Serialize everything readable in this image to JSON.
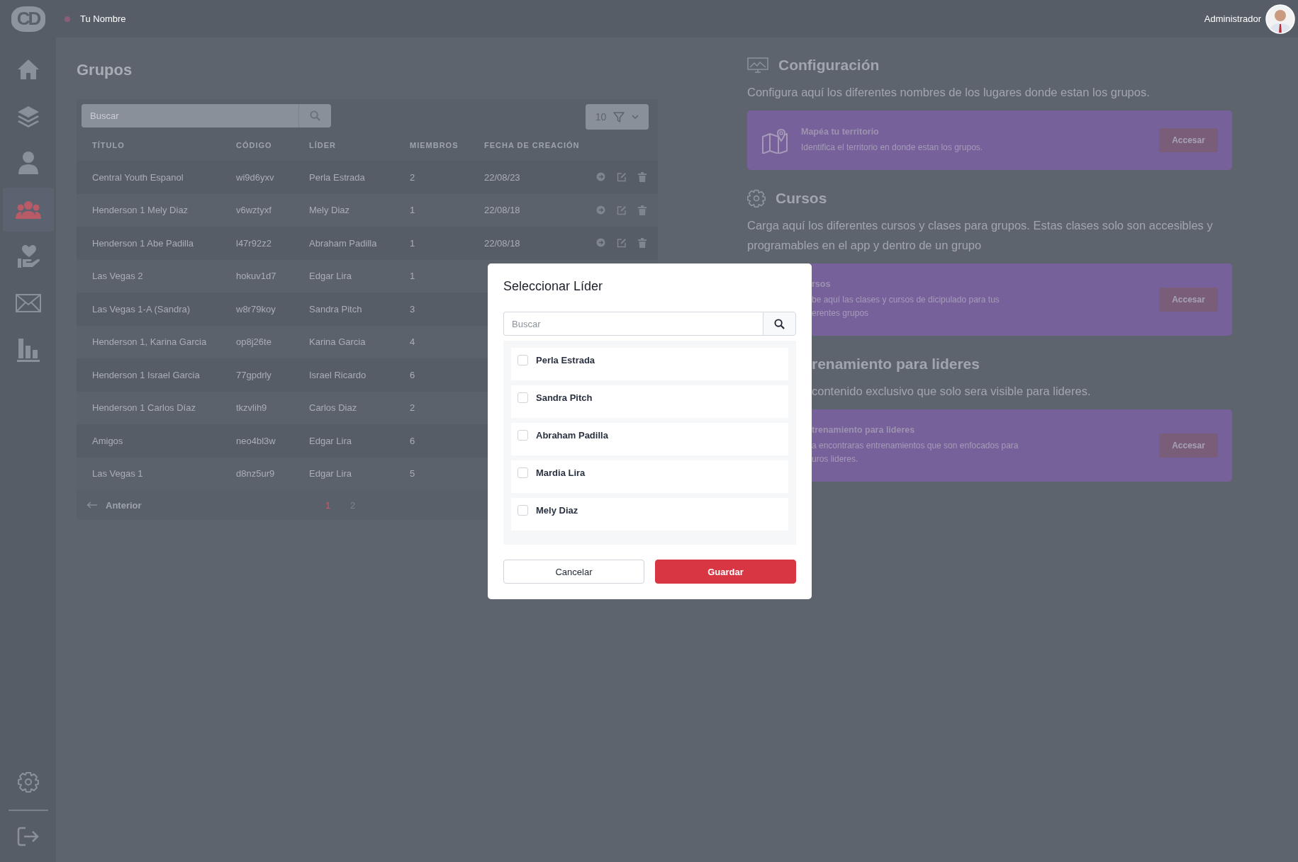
{
  "topbar": {
    "logo": "CD",
    "user_name": "Tu Nombre",
    "role": "Administrador"
  },
  "sidebar": {
    "items": [
      {
        "kind": "home",
        "selected": false
      },
      {
        "kind": "layers",
        "selected": false
      },
      {
        "kind": "user",
        "selected": false
      },
      {
        "kind": "group",
        "selected": true
      },
      {
        "kind": "care",
        "selected": false
      },
      {
        "kind": "mail",
        "selected": false
      },
      {
        "kind": "chart",
        "selected": false
      }
    ],
    "footer": [
      {
        "kind": "settings"
      },
      {
        "kind": "logout"
      }
    ]
  },
  "groups": {
    "title": "Grupos",
    "search": {
      "placeholder": "Buscar"
    },
    "page_size": "10",
    "columns": [
      "TÍTULO",
      "CÓDIGO",
      "LÍDER",
      "MIEMBROS",
      "FECHA DE CREACIÓN"
    ],
    "rows": [
      {
        "cells": [
          "Central Youth Espanol",
          "wi9d6yxv",
          "Perla Estrada",
          "2",
          "22/08/23"
        ]
      },
      {
        "cells": [
          "Henderson 1 Mely Diaz",
          "v6wztyxf",
          "Mely Diaz",
          "1",
          "22/08/18"
        ]
      },
      {
        "cells": [
          "Henderson 1 Abe Padilla",
          "l47r92z2",
          "Abraham Padilla",
          "1",
          "22/08/18"
        ]
      },
      {
        "cells": [
          "Las Vegas 2",
          "hokuv1d7",
          "Edgar Lira",
          "1"
        ]
      },
      {
        "cells": [
          "Las Vegas 1-A (Sandra)",
          "w8r79koy",
          "Sandra Pitch",
          "3"
        ]
      },
      {
        "cells": [
          "Henderson 1, Karina Garcia",
          "op8j26te",
          "Karina Garcia",
          "4"
        ]
      },
      {
        "cells": [
          "Henderson 1 Israel Garcia",
          "77gpdrly",
          "Israel Ricardo",
          "6"
        ]
      },
      {
        "cells": [
          "Henderson 1 Carlos Díaz",
          "tkzvlih9",
          "Carlos Diaz",
          "2"
        ]
      },
      {
        "cells": [
          "Amigos",
          "neo4bl3w",
          "Edgar Lira",
          "6"
        ]
      },
      {
        "cells": [
          "Las Vegas 1",
          "d8nz5ur9",
          "Edgar Lira",
          "5"
        ]
      }
    ],
    "pagination": {
      "previous": "Anterior",
      "pages": [
        {
          "label": "1",
          "selected": true
        },
        {
          "label": "2",
          "selected": false
        }
      ]
    }
  },
  "sections": [
    {
      "title": "Configuración",
      "description": "Configura aquí los diferentes nombres de los lugares donde estan los grupos.",
      "card": {
        "title": "Mapéa tu territorio",
        "text_lines": [
          "Identifica el territorio en donde estan los grupos."
        ],
        "button": "Accesar"
      }
    },
    {
      "title": "Cursos",
      "description": "Carga aquí los diferentes cursos y clases para grupos. Estas clases solo son accesibles y programables en el app y dentro de un grupo",
      "card": {
        "title": "rsos",
        "text_lines": [
          "be aquí las clases y cursos de dicipulado para tus",
          "erentes grupos"
        ],
        "button": "Accesar"
      }
    },
    {
      "title": "renamiento para lideres",
      "description": "contenido exclusivo que solo sera visible para lideres.",
      "card": {
        "title": "trenamiento para lideres",
        "text_lines": [
          "a encontraras entrenamientos que son enfocados para",
          "uros lideres."
        ],
        "button": "Accesar"
      }
    }
  ],
  "modal": {
    "title": "Seleccionar Líder",
    "search": {
      "placeholder": "Buscar"
    },
    "options": [
      {
        "label": "Perla Estrada",
        "checked": false
      },
      {
        "label": "Sandra Pitch",
        "checked": false
      },
      {
        "label": "Abraham Padilla",
        "checked": false
      },
      {
        "label": "Mardia Lira",
        "checked": false
      },
      {
        "label": "Mely Diaz",
        "checked": false
      }
    ],
    "buttons": [
      {
        "label": "Cancelar",
        "kind": "secondary"
      },
      {
        "label": "Guardar",
        "kind": "primary"
      }
    ]
  }
}
